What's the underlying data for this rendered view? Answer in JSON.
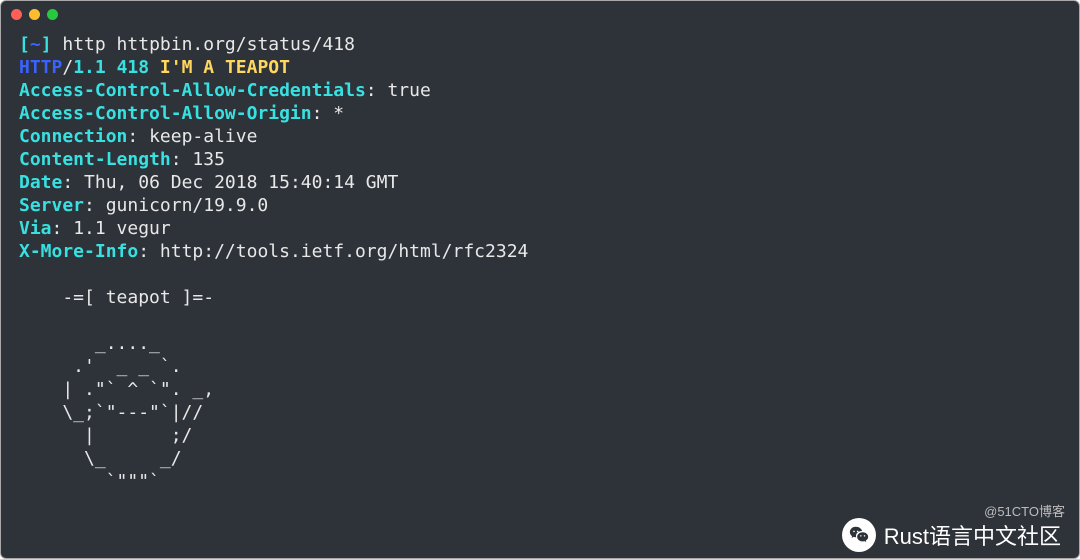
{
  "window": {
    "traffic": {
      "red": "#ff5f56",
      "yellow": "#ffbd2e",
      "green": "#27c93f"
    }
  },
  "prompt": {
    "bracket_open": "[",
    "cwd": "~",
    "bracket_close": "]",
    "command": "http httpbin.org/status/418"
  },
  "status": {
    "protocol": "HTTP",
    "slash": "/",
    "version": "1.1",
    "code": "418",
    "reason": "I'M A TEAPOT"
  },
  "headers": [
    {
      "name": "Access-Control-Allow-Credentials",
      "value": "true"
    },
    {
      "name": "Access-Control-Allow-Origin",
      "value": "*"
    },
    {
      "name": "Connection",
      "value": "keep-alive"
    },
    {
      "name": "Content-Length",
      "value": "135"
    },
    {
      "name": "Date",
      "value": "Thu, 06 Dec 2018 15:40:14 GMT"
    },
    {
      "name": "Server",
      "value": "gunicorn/19.9.0"
    },
    {
      "name": "Via",
      "value": "1.1 vegur"
    },
    {
      "name": "X-More-Info",
      "value": "http://tools.ietf.org/html/rfc2324"
    }
  ],
  "body_art": "\n    -=[ teapot ]=-\n\n       _...._\n     .'  _ _ `.\n    | .\"` ^ `\". _,\n    \\_;`\"---\"`|//\n      |       ;/\n      \\_     _/\n        `\"\"\"`\n",
  "watermark": "@51CTO博客",
  "brand": {
    "text": "Rust语言中文社区"
  }
}
